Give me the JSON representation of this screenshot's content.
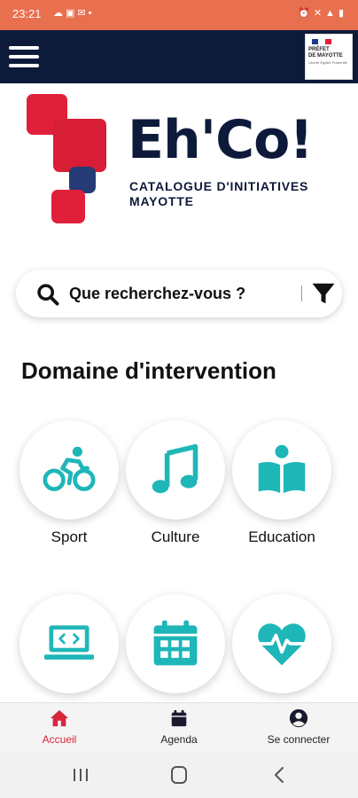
{
  "status_bar": {
    "time": "23:21",
    "left_icons": [
      "cloud-icon",
      "image-icon",
      "mail-icon",
      "dot-icon"
    ],
    "right_icons": [
      "alarm-icon",
      "mute-icon",
      "wifi-icon",
      "signal-icon",
      "battery-icon"
    ],
    "bg_color": "#e8704f"
  },
  "app_bar": {
    "menu_icon": "hamburger-icon",
    "partner_logo": {
      "line1": "PRÉFET",
      "line2": "DE MAYOTTE",
      "motto": "Liberté Égalité Fraternité"
    },
    "bg_color": "#0e1a3a"
  },
  "brand": {
    "name": "Eh'Co!",
    "tagline_1": "CATALOGUE D'INITIATIVES",
    "tagline_2": "MAYOTTE"
  },
  "search": {
    "placeholder": "Que recherchez-vous ?",
    "value": ""
  },
  "section": {
    "title": "Domaine d'intervention"
  },
  "categories": [
    {
      "label": "Sport",
      "icon": "bicycle-icon"
    },
    {
      "label": "Culture",
      "icon": "music-note-icon"
    },
    {
      "label": "Education",
      "icon": "book-reader-icon"
    },
    {
      "label": "",
      "icon": "laptop-code-icon"
    },
    {
      "label": "",
      "icon": "calendar-icon"
    },
    {
      "label": "",
      "icon": "heartbeat-icon"
    }
  ],
  "bottom_nav": [
    {
      "label": "Accueil",
      "icon": "home-icon",
      "active": true
    },
    {
      "label": "Agenda",
      "icon": "calendar-icon",
      "active": false
    },
    {
      "label": "Se connecter",
      "icon": "user-circle-icon",
      "active": false
    }
  ],
  "colors": {
    "accent": "#1fb6b8",
    "brand_red": "#d81d36",
    "brand_navy": "#0e1a3a",
    "nav_active": "#d8253a"
  }
}
